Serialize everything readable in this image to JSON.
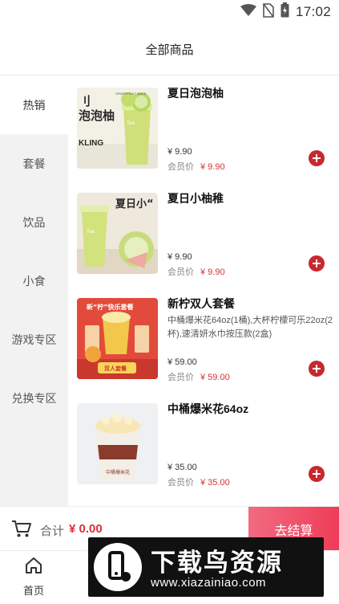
{
  "status": {
    "time": "17:02"
  },
  "header": {
    "title": "全部商品"
  },
  "sidebar": {
    "items": [
      {
        "label": "热销"
      },
      {
        "label": "套餐"
      },
      {
        "label": "饮品"
      },
      {
        "label": "小食"
      },
      {
        "label": "游戏专区"
      },
      {
        "label": "兑换专区"
      }
    ]
  },
  "products": [
    {
      "name": "夏日泡泡柚",
      "desc": "",
      "price": "¥ 9.90",
      "member_label": "会员价",
      "member_price": "¥ 9.90",
      "image_text": {
        "top_en": "GRAPEFRUIT JUICE",
        "cn": "泡泡柚",
        "en": "KLING"
      }
    },
    {
      "name": "夏日小柚稚",
      "desc": "",
      "price": "¥ 9.90",
      "member_label": "会员价",
      "member_price": "¥ 9.90",
      "image_text": {
        "cn": "夏日小“"
      }
    },
    {
      "name": "新柠双人套餐",
      "desc": "中桶爆米花64oz(1桶),大杯柠檬可乐22oz(2杯),速清妍水巾按压款(2盒)",
      "price": "¥ 59.00",
      "member_label": "会员价",
      "member_price": "¥ 59.00",
      "image_text": {
        "banner": "新“柠”快乐套餐",
        "badge": "双人套餐"
      }
    },
    {
      "name": "中桶爆米花64oz",
      "desc": "",
      "price": "¥ 35.00",
      "member_label": "会员价",
      "member_price": "¥ 35.00",
      "image_text": {
        "label": "中桶爆米花"
      }
    }
  ],
  "cart": {
    "total_label": "合计",
    "total_amount": "¥ 0.00",
    "checkout_label": "去结算"
  },
  "tabbar": {
    "home_label": "首页"
  },
  "watermark": {
    "title": "下载鸟资源",
    "url": "www.xiazainiao.com"
  },
  "colors": {
    "accent": "#c8282e",
    "price_red": "#d9303a",
    "checkout": "#ee3d58"
  }
}
